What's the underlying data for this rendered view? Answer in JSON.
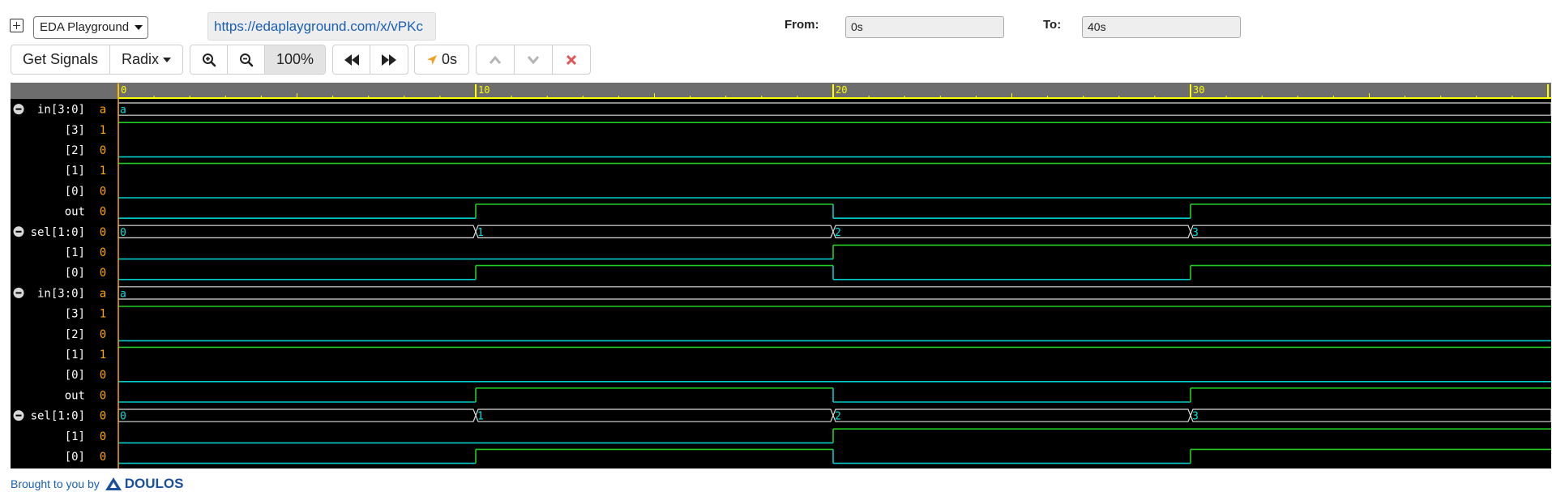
{
  "header": {
    "site_select": "EDA Playground",
    "url": "https://edaplayground.com/x/vPKc",
    "from_label": "From:",
    "from_value": "0s",
    "to_label": "To:",
    "to_value": "40s"
  },
  "toolbar": {
    "get_signals": "Get Signals",
    "radix": "Radix",
    "zoom_level": "100%",
    "cursor_time": "0s"
  },
  "waveform": {
    "time_end": 40,
    "time_markers": [
      "0",
      "10",
      "20",
      "30"
    ],
    "colors": {
      "background": "#000000",
      "ruler": "#6d6d6d",
      "ruler_ticks": "#ffff00",
      "name": "#ffffff",
      "value": "#ffa500",
      "high": "#22cc22",
      "low": "#00cccc",
      "bus": "#dddddd",
      "bus_label": "#00e0e0",
      "cursor": "#ffa500"
    },
    "signals": [
      {
        "name": "in[3:0]",
        "value": "a",
        "kind": "bus",
        "collapse": true,
        "segments": [
          {
            "t": 0,
            "label": "a"
          }
        ]
      },
      {
        "name": "[3]",
        "value": "1",
        "kind": "bit",
        "changes": [
          [
            0,
            1
          ]
        ]
      },
      {
        "name": "[2]",
        "value": "0",
        "kind": "bit",
        "changes": [
          [
            0,
            0
          ]
        ]
      },
      {
        "name": "[1]",
        "value": "1",
        "kind": "bit",
        "changes": [
          [
            0,
            1
          ]
        ]
      },
      {
        "name": "[0]",
        "value": "0",
        "kind": "bit",
        "changes": [
          [
            0,
            0
          ]
        ]
      },
      {
        "name": "out",
        "value": "0",
        "kind": "bit",
        "changes": [
          [
            0,
            0
          ],
          [
            10,
            1
          ],
          [
            20,
            0
          ],
          [
            30,
            1
          ]
        ]
      },
      {
        "name": "sel[1:0]",
        "value": "0",
        "kind": "bus",
        "collapse": true,
        "segments": [
          {
            "t": 0,
            "label": "0"
          },
          {
            "t": 10,
            "label": "1"
          },
          {
            "t": 20,
            "label": "2"
          },
          {
            "t": 30,
            "label": "3"
          }
        ]
      },
      {
        "name": "[1]",
        "value": "0",
        "kind": "bit",
        "changes": [
          [
            0,
            0
          ],
          [
            20,
            1
          ]
        ]
      },
      {
        "name": "[0]",
        "value": "0",
        "kind": "bit",
        "changes": [
          [
            0,
            0
          ],
          [
            10,
            1
          ],
          [
            20,
            0
          ],
          [
            30,
            1
          ]
        ]
      },
      {
        "name": "in[3:0]",
        "value": "a",
        "kind": "bus",
        "collapse": true,
        "segments": [
          {
            "t": 0,
            "label": "a"
          }
        ]
      },
      {
        "name": "[3]",
        "value": "1",
        "kind": "bit",
        "changes": [
          [
            0,
            1
          ]
        ]
      },
      {
        "name": "[2]",
        "value": "0",
        "kind": "bit",
        "changes": [
          [
            0,
            0
          ]
        ]
      },
      {
        "name": "[1]",
        "value": "1",
        "kind": "bit",
        "changes": [
          [
            0,
            1
          ]
        ]
      },
      {
        "name": "[0]",
        "value": "0",
        "kind": "bit",
        "changes": [
          [
            0,
            0
          ]
        ]
      },
      {
        "name": "out",
        "value": "0",
        "kind": "bit",
        "changes": [
          [
            0,
            0
          ],
          [
            10,
            1
          ],
          [
            20,
            0
          ],
          [
            30,
            1
          ]
        ]
      },
      {
        "name": "sel[1:0]",
        "value": "0",
        "kind": "bus",
        "collapse": true,
        "segments": [
          {
            "t": 0,
            "label": "0"
          },
          {
            "t": 10,
            "label": "1"
          },
          {
            "t": 20,
            "label": "2"
          },
          {
            "t": 30,
            "label": "3"
          }
        ]
      },
      {
        "name": "[1]",
        "value": "0",
        "kind": "bit",
        "changes": [
          [
            0,
            0
          ],
          [
            20,
            1
          ]
        ]
      },
      {
        "name": "[0]",
        "value": "0",
        "kind": "bit",
        "changes": [
          [
            0,
            0
          ],
          [
            10,
            1
          ],
          [
            20,
            0
          ],
          [
            30,
            1
          ]
        ]
      }
    ]
  },
  "footer": {
    "text": "Brought to you by",
    "brand": "DOULOS"
  },
  "icons": {
    "expand": "plus-square-icon",
    "zoom_in": "zoom-in-icon",
    "zoom_out": "zoom-out-icon",
    "first": "fast-backward-icon",
    "last": "fast-forward-icon",
    "cursor": "location-arrow-icon",
    "prev": "chevron-up-icon",
    "next": "chevron-down-icon",
    "remove": "close-icon"
  }
}
